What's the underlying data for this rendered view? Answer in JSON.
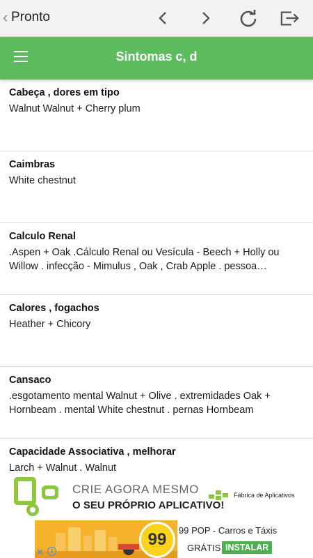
{
  "topbar": {
    "back_label": "Pronto",
    "icons": [
      "chevron-left-icon",
      "chevron-right-icon",
      "refresh-icon",
      "exit-icon"
    ]
  },
  "appbar": {
    "title": "Sintomas c, d",
    "menu_icon": "hamburger-icon",
    "color": "#5cbc5e"
  },
  "items": [
    {
      "title": "Cabeça , dores em tipo",
      "desc": "Walnut Walnut + Cherry plum"
    },
    {
      "title": "Caimbras",
      "desc": "White chestnut"
    },
    {
      "title": "Calculo Renal",
      "desc": ".Aspen + Oak .Cálculo Renal ou Vesícula - Beech + Holly ou Willow . infecção - Mimulus , Oak , Crab Apple . pessoa…"
    },
    {
      "title": "Calores , fogachos",
      "desc": "Heather + Chicory"
    },
    {
      "title": "Cansaco",
      "desc": ".esgotamento mental Walnut + Olive . extremidades Oak + Hornbeam . mental White chestnut . pernas Hornbeam"
    },
    {
      "title": "Capacidade Associativa , melhorar",
      "desc": "Larch + Walnut . Walnut"
    }
  ],
  "ad_banner": {
    "line1": "CRIE AGORA MESMO",
    "line2": "O SEU PRÓPRIO APLICATIVO!",
    "brand": "Fábrica de Aplicativos"
  },
  "ad_app": {
    "badge": "99",
    "title": "99 POP - Carros e Táxis",
    "gratis": "GRÁTIS",
    "install": "INSTALAR",
    "close": "✕",
    "info": "i"
  }
}
